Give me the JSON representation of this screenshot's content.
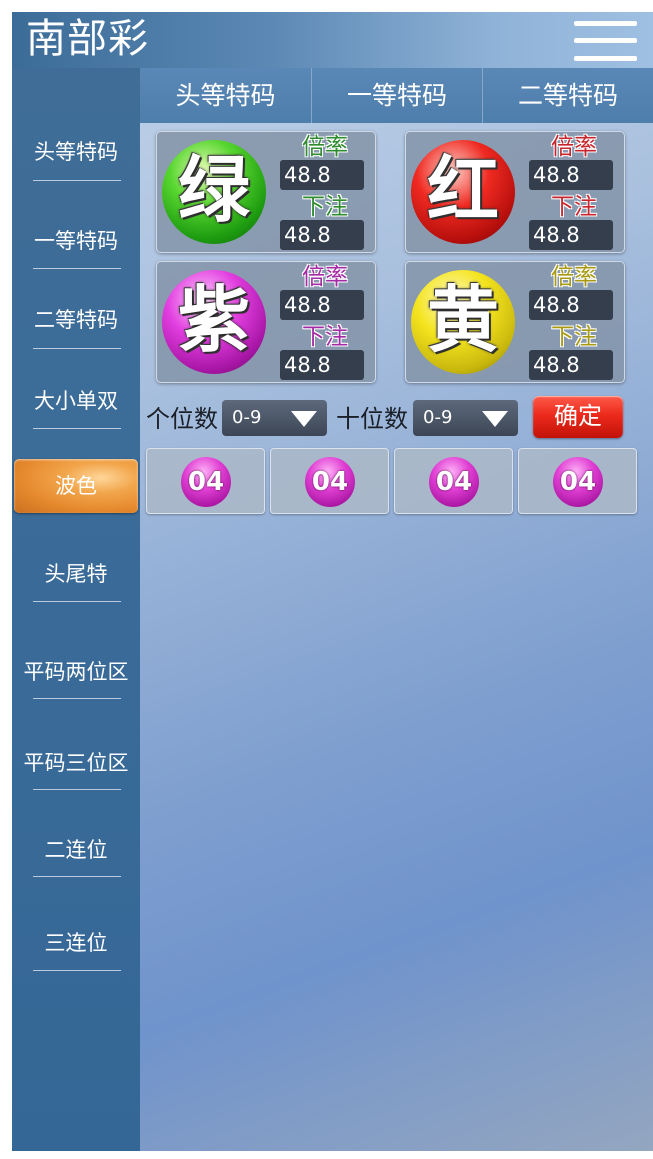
{
  "header": {
    "title": "南部彩"
  },
  "tabs": [
    {
      "label": "头等特码"
    },
    {
      "label": "一等特码"
    },
    {
      "label": "二等特码"
    }
  ],
  "sidebar": {
    "items": [
      {
        "label": "头等特码"
      },
      {
        "label": "一等特码"
      },
      {
        "label": "二等特码"
      },
      {
        "label": "大小单双"
      },
      {
        "label": "波色",
        "active": true
      },
      {
        "label": "头尾特"
      },
      {
        "label": "平码两位区"
      },
      {
        "label": "平码三位区"
      },
      {
        "label": "二连位"
      },
      {
        "label": "三连位"
      }
    ]
  },
  "cards": [
    {
      "char": "绿",
      "color": "green",
      "label_color": "#2e8b2e",
      "rate_label": "倍率",
      "rate": "48.8",
      "bet_label": "下注",
      "bet": "48.8"
    },
    {
      "char": "红",
      "color": "red",
      "label_color": "#c8262c",
      "rate_label": "倍率",
      "rate": "48.8",
      "bet_label": "下注",
      "bet": "48.8"
    },
    {
      "char": "紫",
      "color": "purple",
      "label_color": "#a52aa5",
      "rate_label": "倍率",
      "rate": "48.8",
      "bet_label": "下注",
      "bet": "48.8"
    },
    {
      "char": "黄",
      "color": "yellow",
      "label_color": "#a89a12",
      "rate_label": "倍率",
      "rate": "48.8",
      "bet_label": "下注",
      "bet": "48.8"
    }
  ],
  "filter": {
    "units_label": "个位数",
    "units_value": "0-9",
    "tens_label": "十位数",
    "tens_value": "0-9",
    "confirm_label": "确定"
  },
  "numbers": [
    "04",
    "04",
    "04",
    "04"
  ]
}
